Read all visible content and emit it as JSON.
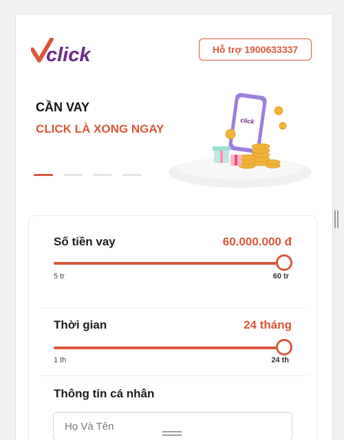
{
  "header": {
    "logo_text": "click",
    "support_label": "Hỗ trợ 1900633337"
  },
  "hero": {
    "line1": "CẦN VAY",
    "line2": "CLICK LÀ XONG NGAY",
    "phone_logo_text": "click",
    "slides_total": 4,
    "active_slide": 1
  },
  "loan": {
    "amount_label": "Số tiền vay",
    "amount_value": "60.000.000 đ",
    "amount_min": "5 tr",
    "amount_max": "60 tr",
    "amount_fraction": 1.0,
    "term_label": "Thời gian",
    "term_value": "24 tháng",
    "term_min": "1 th",
    "term_max": "24 th",
    "term_fraction": 1.0
  },
  "personal": {
    "title": "Thông tin cá nhân",
    "name_placeholder": "Họ Và Tên",
    "name_value": ""
  },
  "colors": {
    "accent": "#d9573b",
    "logo_purple": "#6b2a88"
  }
}
